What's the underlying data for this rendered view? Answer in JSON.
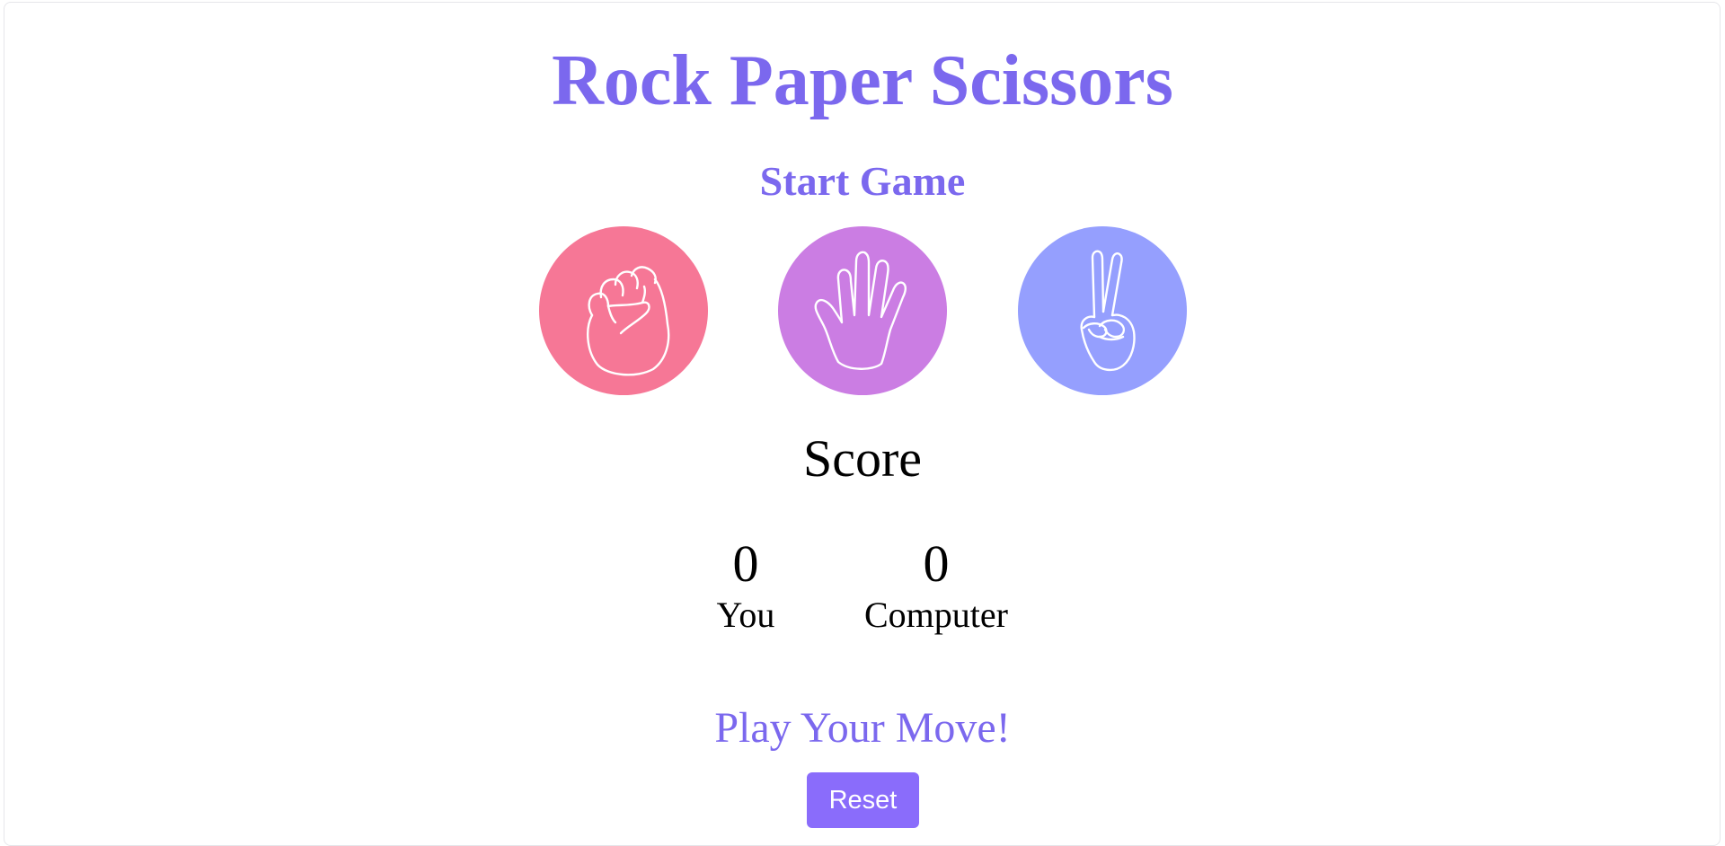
{
  "header": {
    "title": "Rock Paper Scissors",
    "subtitle": "Start Game"
  },
  "choices": [
    {
      "id": "rock",
      "icon": "fist-icon",
      "color": "#f67796"
    },
    {
      "id": "paper",
      "icon": "open-hand-icon",
      "color": "#cb7de3"
    },
    {
      "id": "scissors",
      "icon": "peace-hand-icon",
      "color": "#959ffe"
    }
  ],
  "score": {
    "title": "Score",
    "you_value": "0",
    "you_label": "You",
    "computer_value": "0",
    "computer_label": "Computer"
  },
  "message": "Play Your Move!",
  "controls": {
    "reset_label": "Reset"
  },
  "colors": {
    "accent": "#7b68ee",
    "button": "#8a6cfb"
  }
}
